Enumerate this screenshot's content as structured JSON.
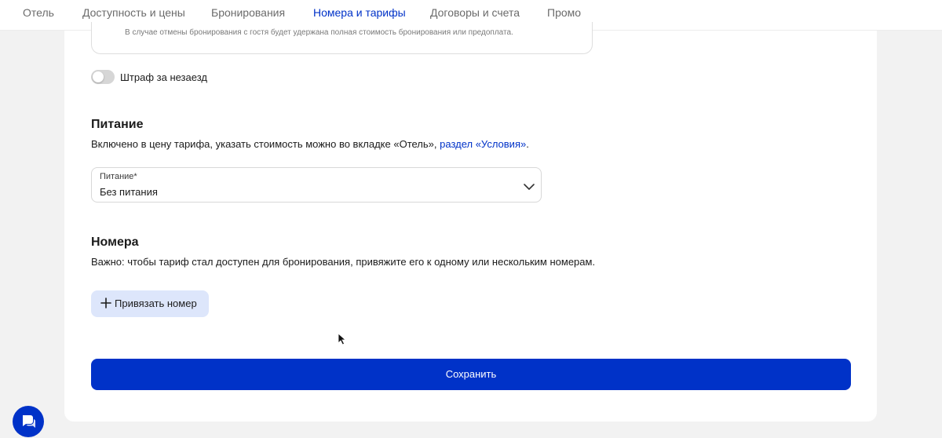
{
  "nav": {
    "items": [
      {
        "label": "Отель"
      },
      {
        "label": "Доступность и цены"
      },
      {
        "label": "Бронирования"
      },
      {
        "label": "Номера и тарифы",
        "active": true
      },
      {
        "label": "Договоры и счета"
      },
      {
        "label": "Промо"
      }
    ]
  },
  "cancellation": {
    "policy_text": "В случае отмены бронирования с гостя будет удержана полная стоимость бронирования или предоплата."
  },
  "no_show": {
    "toggle_label": "Штраф за незаезд",
    "enabled": false
  },
  "meals": {
    "title": "Питание",
    "description": "Включено в цену тарифа, указать стоимость можно во вкладке «Отель», ",
    "link_text": "раздел «Условия»",
    "description_end": ".",
    "select_label": "Питание*",
    "select_value": "Без питания"
  },
  "rooms": {
    "title": "Номера",
    "description": "Важно: чтобы тариф стал доступен для бронирования, привяжите его к одному или нескольким номерам.",
    "bind_button_label": "Привязать номер"
  },
  "save_button_label": "Сохранить",
  "colors": {
    "accent": "#0032c8",
    "secondary_button": "#dde6fb",
    "background": "#f2f2f2"
  },
  "icons": {
    "chevron": "chevron-down-icon",
    "plus": "plus-icon",
    "chat": "chat-icon",
    "cursor": "cursor-icon"
  }
}
